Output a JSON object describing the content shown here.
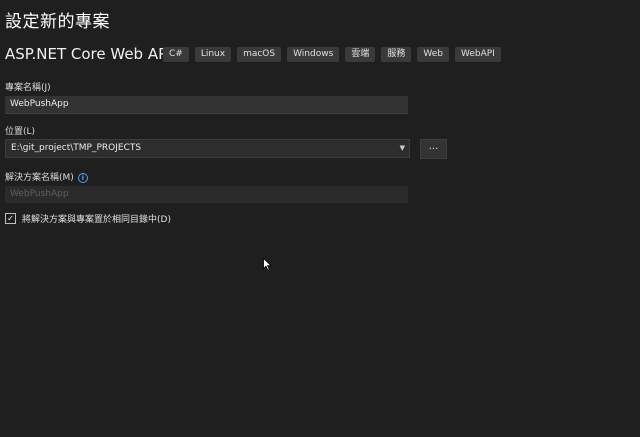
{
  "page": {
    "title": "設定新的專案",
    "template_name": "ASP.NET Core Web API"
  },
  "tags": [
    "C#",
    "Linux",
    "macOS",
    "Windows",
    "雲端",
    "服務",
    "Web",
    "WebAPI"
  ],
  "form": {
    "project_name": {
      "label": "專案名稱(J)",
      "value": "WebPushApp"
    },
    "location": {
      "label": "位置(L)",
      "value": "E:\\git_project\\TMP_PROJECTS",
      "browse_label": "..."
    },
    "solution_name": {
      "label": "解決方案名稱(M)",
      "placeholder": "WebPushApp",
      "info_icon": "info-icon"
    },
    "same_directory": {
      "label": "將解決方案與專案置於相同目錄中(D)",
      "checked": true,
      "check_glyph": "✓"
    }
  },
  "icons": {
    "dropdown": "chevron-down-icon",
    "cursor": "mouse-pointer-icon"
  },
  "colors": {
    "background": "#1f1f1f",
    "input_background": "#333333",
    "tag_background": "#3a3a3a",
    "info_blue": "#4aa3ff"
  }
}
